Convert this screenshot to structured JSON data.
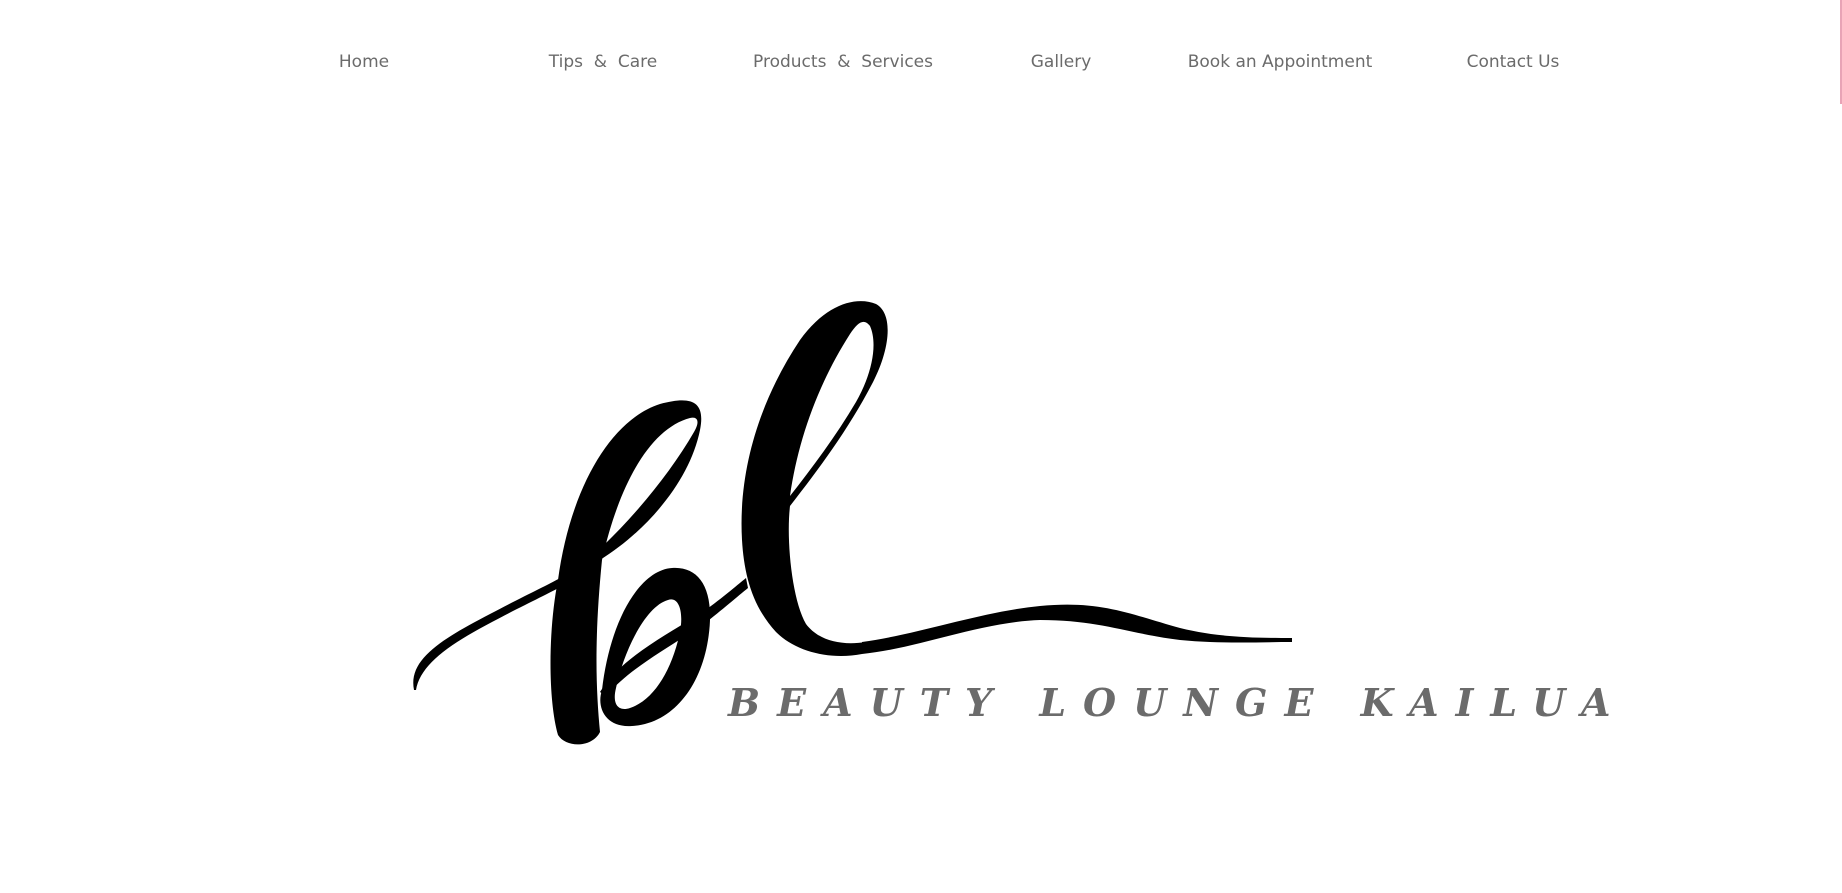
{
  "nav": {
    "items": [
      {
        "label": "Home"
      },
      {
        "label": "Tips  &  Care"
      },
      {
        "label": "Products  &  Services"
      },
      {
        "label": "Gallery"
      },
      {
        "label": "Book an Appointment"
      },
      {
        "label": "Contact Us"
      }
    ]
  },
  "logo": {
    "monogram": "bl",
    "wordmark": "BEAUTY LOUNGE KAILUA"
  },
  "colors": {
    "nav_text": "#6b6b6b",
    "logo_ink": "#000000",
    "wordmark": "#6b6b6b",
    "edge_accent": "#e8a3b6"
  }
}
